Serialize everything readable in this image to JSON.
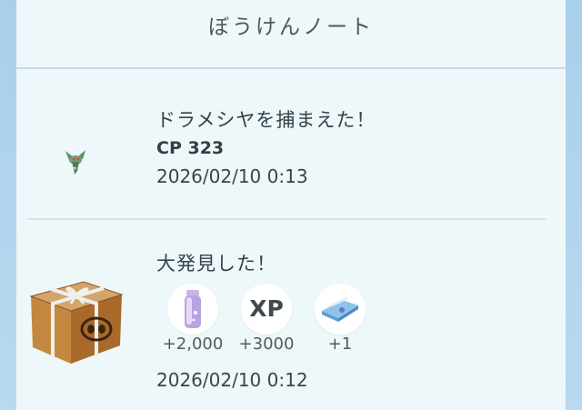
{
  "header": {
    "title": "ぼうけんノート"
  },
  "entries": [
    {
      "headline": "ドラメシヤを捕まえた！",
      "cp": "CP 323",
      "timestamp": "2026/02/10 0:13",
      "icon": "dreepy-icon"
    },
    {
      "headline": "大発見した！",
      "timestamp": "2026/02/10 0:12",
      "icon": "gift-box-icon",
      "rewards": [
        {
          "icon": "stardust-icon",
          "amount": "+2,000"
        },
        {
          "icon": "xp-icon",
          "label": "XP",
          "amount": "+3000"
        },
        {
          "icon": "ticket-icon",
          "amount": "+1"
        }
      ]
    }
  ]
}
